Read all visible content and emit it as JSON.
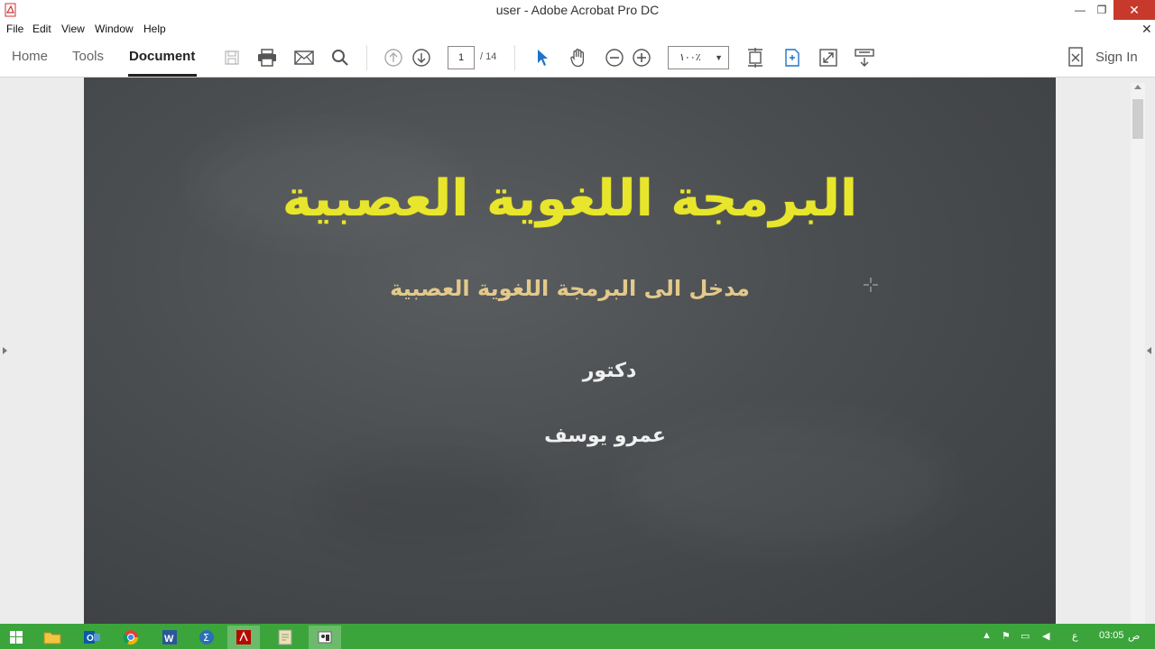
{
  "window": {
    "title": "user - Adobe Acrobat Pro DC",
    "minimize_glyph": "—",
    "maximize_glyph": "❐",
    "close_glyph": "✕",
    "doc_close_glyph": "✕"
  },
  "menu": [
    "File",
    "Edit",
    "View",
    "Window",
    "Help"
  ],
  "nav": {
    "home": "Home",
    "tools": "Tools",
    "document": "Document",
    "sign_in": "Sign In"
  },
  "toolbar": {
    "current_page": "1",
    "total_pages": "/ 14",
    "zoom": "١٠٠٪"
  },
  "document": {
    "heading": "البرمجة اللغوية العصبية",
    "subheading": "مدخل الى البرمجة اللغوية العصبية",
    "role": "دكتور",
    "name": "عمرو يوسف"
  },
  "taskbar": {
    "apps": [
      "windows-start",
      "file-explorer",
      "outlook",
      "chrome",
      "word",
      "sigma-app",
      "acrobat",
      "notes-app",
      "paint-app"
    ],
    "tray": {
      "lang": "ع",
      "time": "03:05",
      "period": "ص"
    }
  },
  "colors": {
    "taskbar": "#3ba53b",
    "heading": "#e8e62c",
    "subheading": "#e3c98a",
    "chalkboard": "#4a4d50",
    "close_button": "#c7392b"
  }
}
